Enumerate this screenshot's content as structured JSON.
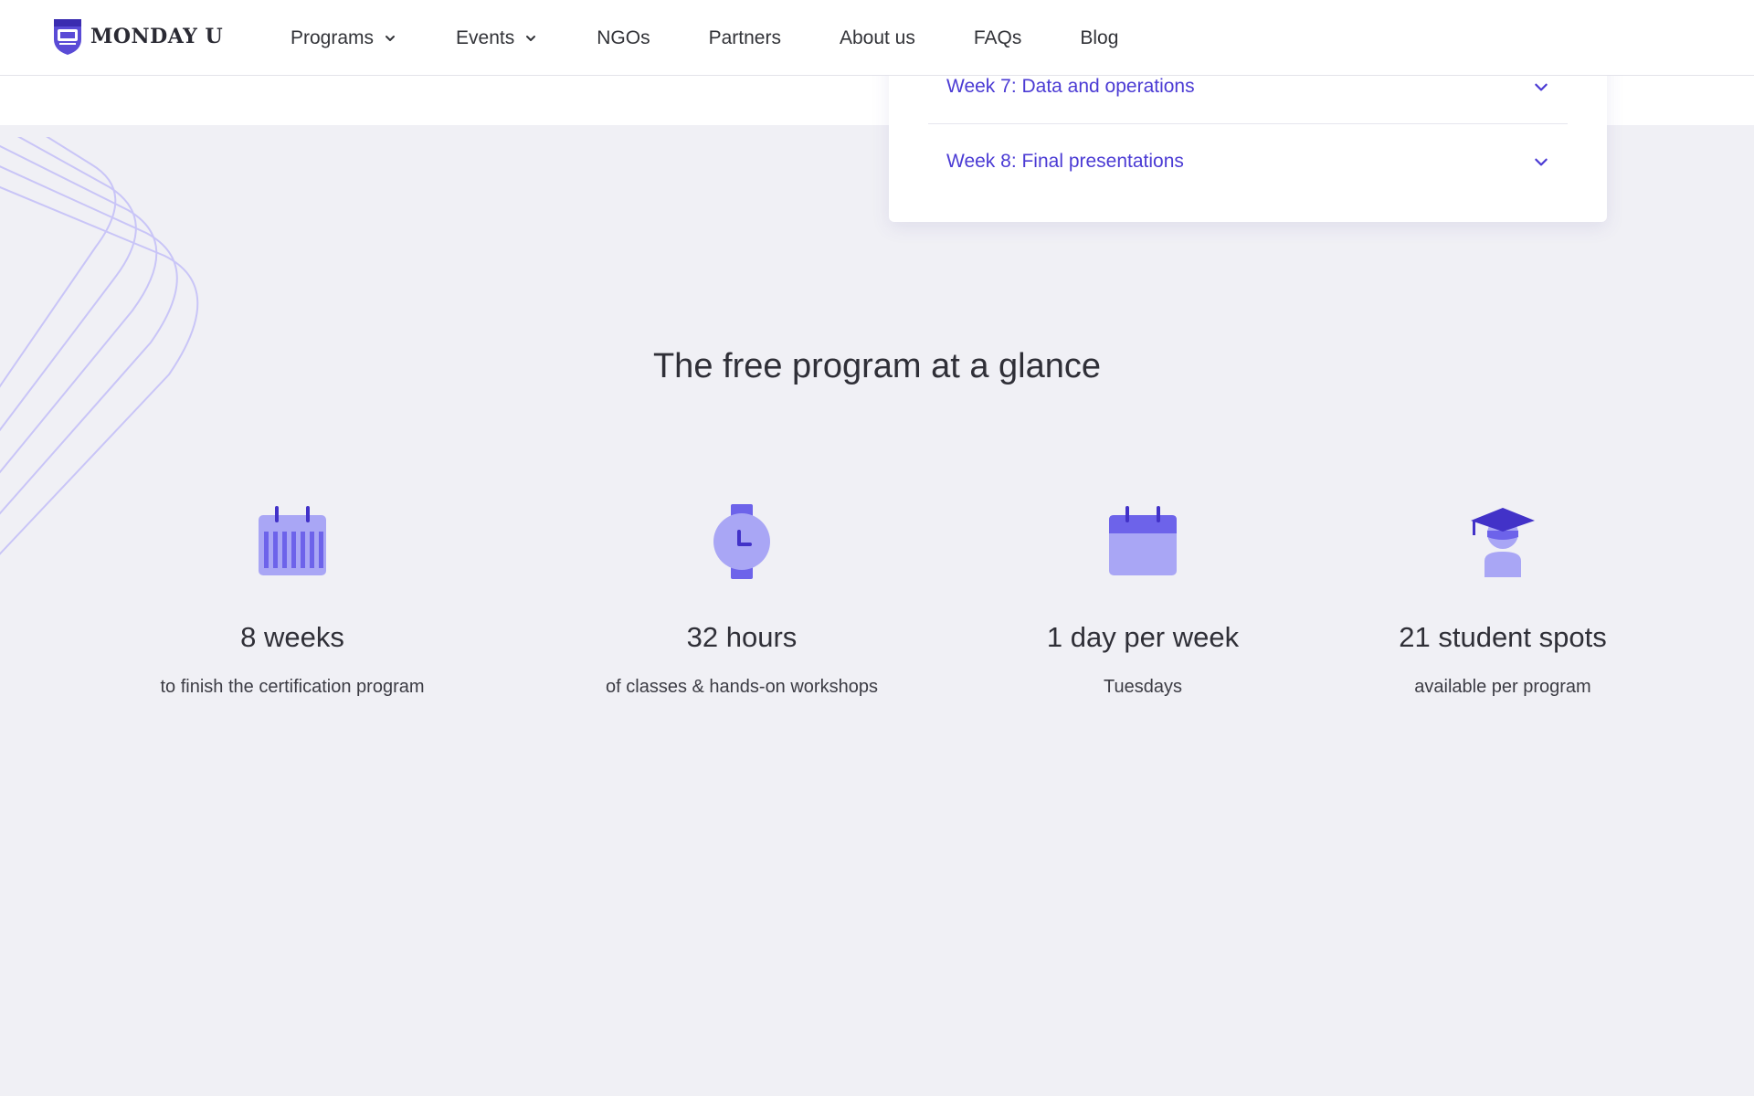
{
  "header": {
    "logo_text": "MONDAY U",
    "nav": [
      {
        "label": "Programs",
        "has_dropdown": true
      },
      {
        "label": "Events",
        "has_dropdown": true
      },
      {
        "label": "NGOs",
        "has_dropdown": false
      },
      {
        "label": "Partners",
        "has_dropdown": false
      },
      {
        "label": "About us",
        "has_dropdown": false
      },
      {
        "label": "FAQs",
        "has_dropdown": false
      },
      {
        "label": "Blog",
        "has_dropdown": false
      }
    ]
  },
  "accordion": {
    "items": [
      {
        "title": "Week 7: Data and operations",
        "icon": "chevron-down-icon"
      },
      {
        "title": "Week 8: Final presentations",
        "icon": "chevron-down-icon"
      }
    ]
  },
  "glance": {
    "title": "The free program at a glance",
    "stats": [
      {
        "icon": "calendar-weeks-icon",
        "value": "8 weeks",
        "description": "to finish the certification program"
      },
      {
        "icon": "watch-icon",
        "value": "32 hours",
        "description": "of classes & hands-on workshops"
      },
      {
        "icon": "calendar-icon",
        "value": "1 day per week",
        "description": "Tuesdays"
      },
      {
        "icon": "graduate-icon",
        "value": "21 student spots",
        "description": "available per program"
      }
    ]
  },
  "colors": {
    "accent": "#4b3bd4",
    "icon_light": "#a9a6f5",
    "icon_mid": "#6d63ea",
    "icon_dark": "#4232c8",
    "background": "#f0f0f5"
  }
}
